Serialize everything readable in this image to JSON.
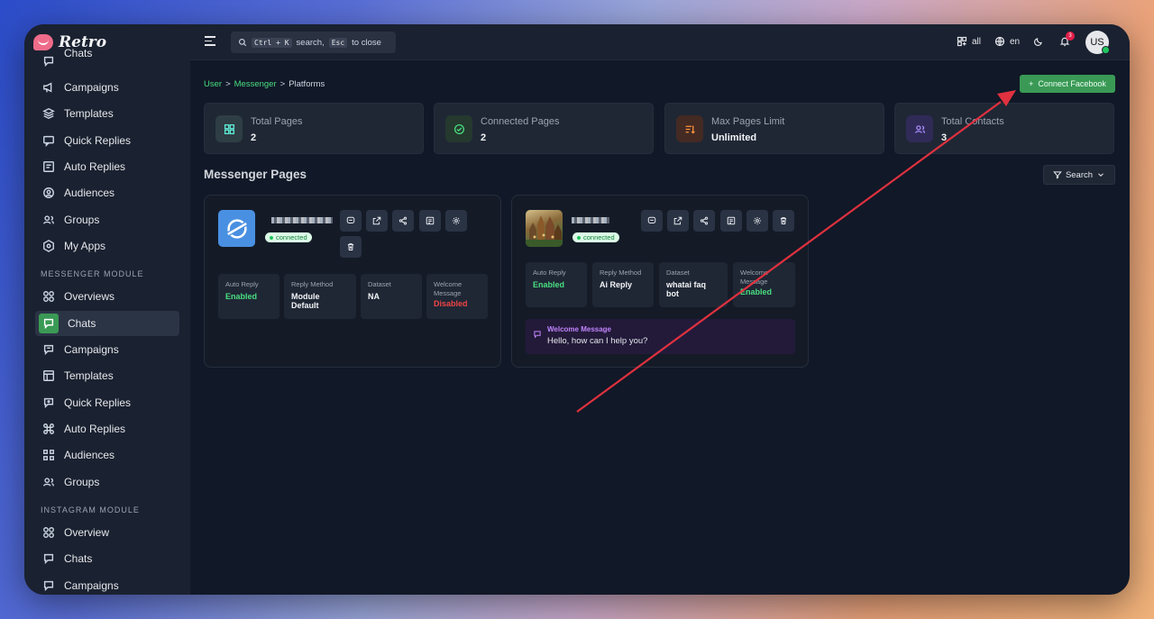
{
  "app": {
    "name": "Retro"
  },
  "sidebar": {
    "top_items": [
      {
        "label": "Chats",
        "icon": "chat-icon"
      },
      {
        "label": "Campaigns",
        "icon": "megaphone-icon"
      },
      {
        "label": "Templates",
        "icon": "layers-icon"
      },
      {
        "label": "Quick Replies",
        "icon": "reply-icon"
      },
      {
        "label": "Auto Replies",
        "icon": "auto-reply-icon"
      },
      {
        "label": "Audiences",
        "icon": "audience-icon"
      },
      {
        "label": "Groups",
        "icon": "group-icon"
      },
      {
        "label": "My Apps",
        "icon": "apps-icon"
      }
    ],
    "messenger_section": "MESSENGER MODULE",
    "messenger_items": [
      {
        "label": "Overviews",
        "icon": "grid-icon"
      },
      {
        "label": "Chats",
        "icon": "chat-icon",
        "active": true
      },
      {
        "label": "Campaigns",
        "icon": "megaphone-icon"
      },
      {
        "label": "Templates",
        "icon": "template-icon"
      },
      {
        "label": "Quick Replies",
        "icon": "reply-icon"
      },
      {
        "label": "Auto Replies",
        "icon": "command-icon"
      },
      {
        "label": "Audiences",
        "icon": "audience-icon"
      },
      {
        "label": "Groups",
        "icon": "group-icon"
      }
    ],
    "instagram_section": "INSTAGRAM MODULE",
    "instagram_items": [
      {
        "label": "Overview",
        "icon": "grid-icon"
      },
      {
        "label": "Chats",
        "icon": "chat-icon"
      },
      {
        "label": "Campaigns",
        "icon": "megaphone-icon"
      }
    ]
  },
  "topbar": {
    "search_prefix": "Ctrl + K",
    "search_middle": "search,",
    "search_key": "Esc",
    "search_suffix": "to close",
    "workspace": "all",
    "language": "en",
    "notifications_count": "3",
    "avatar_initials": "US"
  },
  "breadcrumb": {
    "items": [
      "User",
      "Messenger",
      "Platforms"
    ],
    "separator": ">"
  },
  "actions": {
    "connect_label": "Connect Facebook",
    "search_label": "Search"
  },
  "stats": [
    {
      "label": "Total Pages",
      "value": "2",
      "color": "#2f4a4a",
      "stroke": "#5eead4"
    },
    {
      "label": "Connected Pages",
      "value": "2",
      "color": "#254033",
      "stroke": "#4ade80"
    },
    {
      "label": "Max Pages Limit",
      "value": "Unlimited",
      "color": "#4a2c25",
      "stroke": "#fb923c"
    },
    {
      "label": "Total Contacts",
      "value": "3",
      "color": "#33295a",
      "stroke": "#a78bfa"
    }
  ],
  "section_title": "Messenger Pages",
  "pages": [
    {
      "status": "connected",
      "fields": [
        {
          "label": "Auto Reply",
          "value": "Enabled",
          "tone": "green"
        },
        {
          "label": "Reply Method",
          "value": "Module Default",
          "tone": ""
        },
        {
          "label": "Dataset",
          "value": "NA",
          "tone": ""
        },
        {
          "label": "Welcome Message",
          "value": "Disabled",
          "tone": "red"
        }
      ]
    },
    {
      "status": "connected",
      "fields": [
        {
          "label": "Auto Reply",
          "value": "Enabled",
          "tone": "green"
        },
        {
          "label": "Reply Method",
          "value": "Ai Reply",
          "tone": ""
        },
        {
          "label": "Dataset",
          "value": "whatai faq bot",
          "tone": ""
        },
        {
          "label": "Welcome Message",
          "value": "Enabled",
          "tone": "green"
        }
      ],
      "welcome_label": "Welcome Message",
      "welcome_text": "Hello, how can I help you?"
    }
  ],
  "colors": {
    "accent": "#3a9a55",
    "annotation_arrow": "#e0313f"
  }
}
